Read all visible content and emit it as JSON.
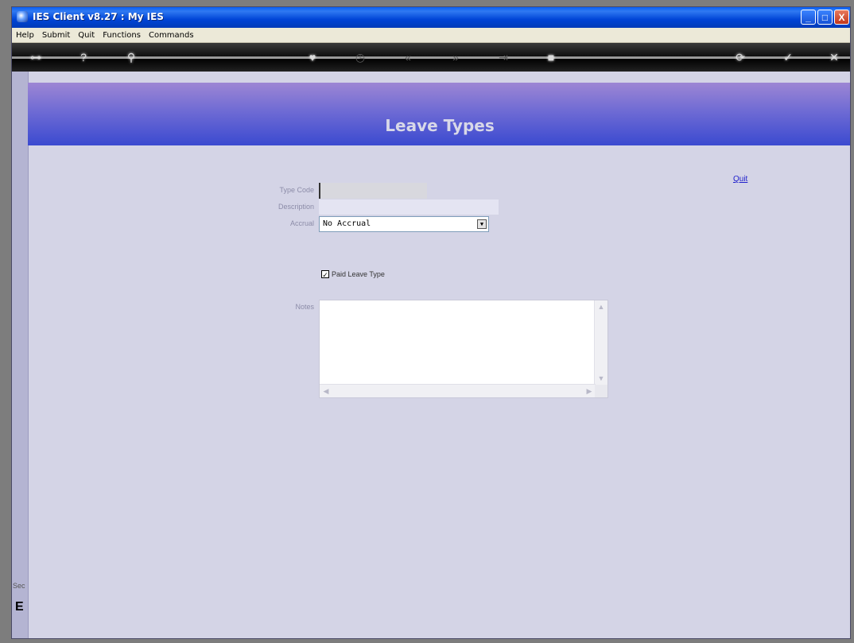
{
  "window": {
    "title": "IES Client v8.27 : My IES",
    "minimize_label": "_",
    "maximize_label": "□",
    "close_label": "X"
  },
  "menu": {
    "items": [
      "Help",
      "Submit",
      "Quit",
      "Functions",
      "Commands"
    ]
  },
  "toolbar": {
    "icons": [
      {
        "name": "key-icon",
        "glyph": "⊶",
        "enabled": true
      },
      {
        "name": "help-icon",
        "glyph": "?",
        "enabled": true
      },
      {
        "name": "search-icon",
        "glyph": "⚲",
        "enabled": true
      },
      {
        "name": "heart-icon",
        "glyph": "♥",
        "enabled": true
      },
      {
        "name": "clock-icon",
        "glyph": "◷",
        "enabled": false
      },
      {
        "name": "rewind-icon",
        "glyph": "«",
        "enabled": false
      },
      {
        "name": "forward-icon",
        "glyph": "»",
        "enabled": false
      },
      {
        "name": "export-icon",
        "glyph": "⇥",
        "enabled": false
      },
      {
        "name": "stop-icon",
        "glyph": "■",
        "enabled": true
      },
      {
        "name": "refresh-icon",
        "glyph": "⟳",
        "enabled": true
      },
      {
        "name": "ok-icon",
        "glyph": "✓",
        "enabled": true
      },
      {
        "name": "cancel-icon",
        "glyph": "✕",
        "enabled": true
      }
    ]
  },
  "sidebar": {
    "label": "Sec",
    "glyph": "E"
  },
  "page": {
    "title": "Leave Types",
    "quit_link": "Quit"
  },
  "form": {
    "type_code": {
      "label": "Type Code",
      "value": ""
    },
    "description": {
      "label": "Description",
      "value": ""
    },
    "accrual": {
      "label": "Accrual",
      "value": "No Accrual"
    },
    "paid_leave": {
      "label": "Paid Leave Type",
      "checked": true
    },
    "notes": {
      "label": "Notes",
      "value": ""
    }
  },
  "colors": {
    "header_top": "#9d86d4",
    "header_bottom": "#3b4ad0",
    "body_bg": "#d4d4e6",
    "link": "#2020cc"
  }
}
